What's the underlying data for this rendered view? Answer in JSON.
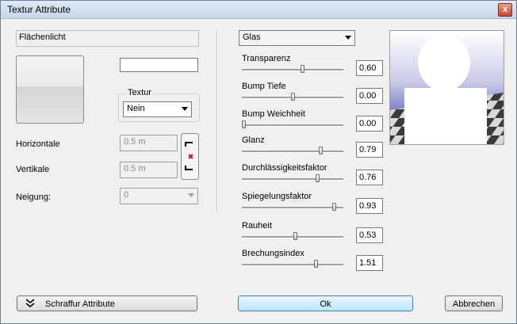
{
  "window": {
    "title": "Textur Attribute",
    "close_label": "x"
  },
  "left": {
    "name_label": "Flächenlicht",
    "texture_group_label": "Textur",
    "texture_value": "Nein",
    "horizontal_label": "Horizontale",
    "horizontal_value": "0.5 m",
    "vertical_label": "Vertikale",
    "vertical_value": "0.5 m",
    "tilt_label": "Neigung:",
    "tilt_value": "0"
  },
  "material": {
    "selected": "Glas"
  },
  "sliders": [
    {
      "label": "Transparenz",
      "value": "0.60",
      "level": 0.6
    },
    {
      "label": "Bump Tiefe",
      "value": "0.00",
      "level": 0.5
    },
    {
      "label": "Bump Weichheit",
      "value": "0.00",
      "level": 0.0
    },
    {
      "label": "Glanz",
      "value": "0.79",
      "level": 0.79
    },
    {
      "label": "Durchlässigkeitsfaktor",
      "value": "0.76",
      "level": 0.76
    },
    {
      "label": "Spiegelungsfaktor",
      "value": "0.93",
      "level": 0.93
    },
    {
      "label": "Rauheit",
      "value": "0.53",
      "level": 0.53
    },
    {
      "label": "Brechungsindex",
      "value": "1.51",
      "level": 0.74
    }
  ],
  "buttons": {
    "hatch": "Schraffur Attribute",
    "ok": "Ok",
    "cancel": "Abbrechen"
  }
}
